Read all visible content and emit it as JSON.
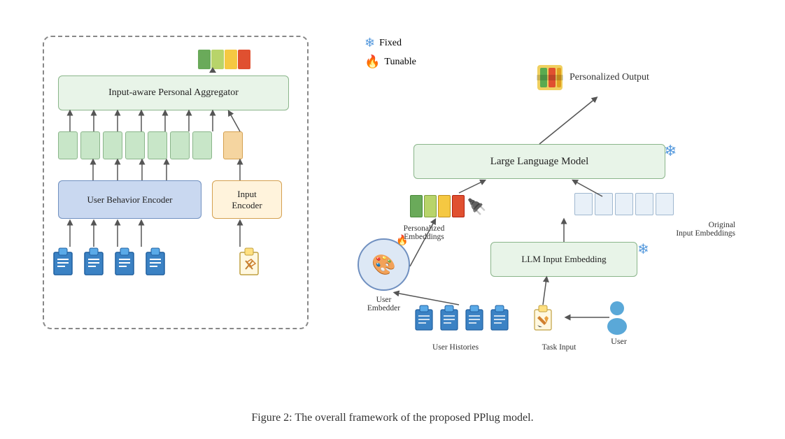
{
  "legend": {
    "fixed_label": "Fixed",
    "tunable_label": "Tunable"
  },
  "left": {
    "aggregator_label": "Input-aware Personal Aggregator",
    "behavior_encoder_label": "User Behavior Encoder",
    "input_encoder_label": "Input\nEncoder"
  },
  "right": {
    "llm_label": "Large Language Model",
    "llm_embed_label": "LLM Input Embedding",
    "pers_output_label": "Personalized Output",
    "pers_embed_label": "Personalized\nEmbeddings",
    "orig_embed_label": "Original\nInput Embeddings",
    "user_embedder_label": "User\nEmbedder",
    "user_hist_label": "User Histories",
    "task_input_label": "Task Input",
    "user_label": "User"
  },
  "caption": "Figure 2: The overall framework of the proposed PPlug model."
}
